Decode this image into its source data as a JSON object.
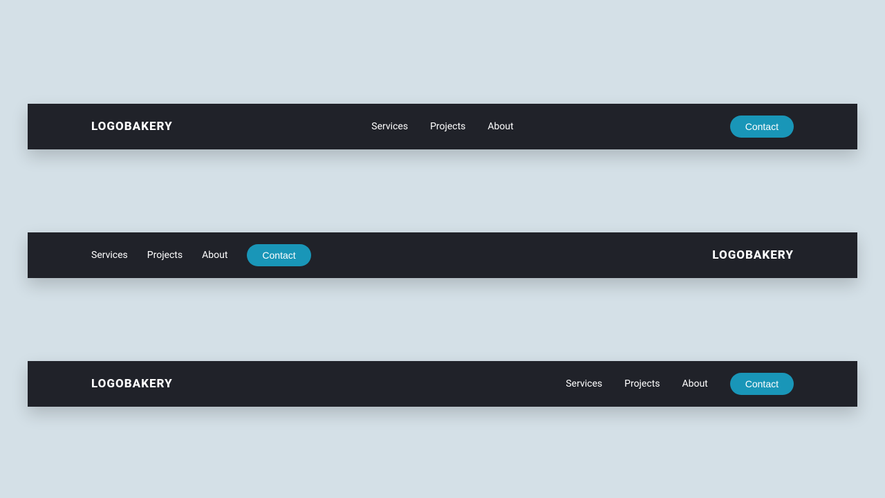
{
  "brand": "LOGOBAKERY",
  "nav": {
    "services": "Services",
    "projects": "Projects",
    "about": "About",
    "contact": "Contact"
  },
  "colors": {
    "background": "#d4e0e7",
    "navbar": "#202229",
    "accent": "#1996b8"
  }
}
